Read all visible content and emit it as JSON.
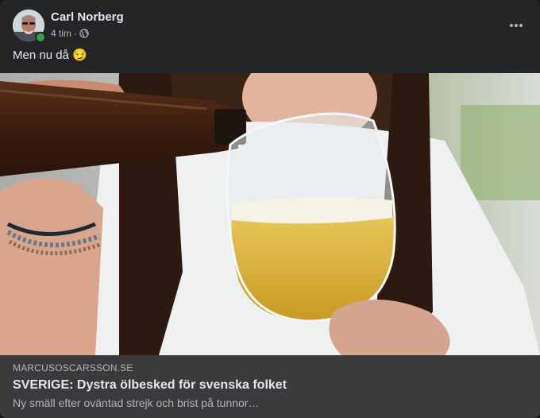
{
  "post": {
    "author": "Carl Norberg",
    "time": "4 tim",
    "separator": "·",
    "text": "Men nu då",
    "emoji": "😏",
    "privacy_icon": "globe-icon",
    "menu_icon": "more-dots-icon"
  },
  "link": {
    "domain": "MARCUSOSCARSSON.SE",
    "title": "SVERIGE: Dystra ölbesked för svenska folket",
    "description": "Ny smäll efter oväntad strejk och brist på tunnor…"
  },
  "colors": {
    "card": "#242526",
    "link_bg": "#3a3b3c",
    "primary_text": "#e4e6eb",
    "secondary_text": "#b0b3b8",
    "online": "#31a24c"
  }
}
